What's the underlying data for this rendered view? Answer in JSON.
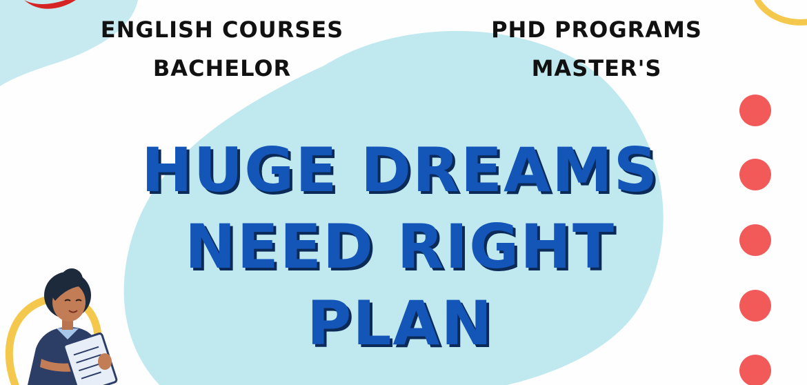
{
  "tags": {
    "left_top": "ENGLISH COURSES",
    "left_bottom": "BACHELOR",
    "right_top": "PHD PROGRAMS",
    "right_bottom": "MASTER'S"
  },
  "headline": {
    "line1": "HUGE DREAMS",
    "line2": "NEED RIGHT",
    "line3": "PLAN"
  },
  "colors": {
    "headline": "#1455b8",
    "headline_shadow": "#0b2a57",
    "blob": "#bfe8ef",
    "dots": "#f25a5a",
    "ring": "#f4c84c",
    "swoosh": "#d62424"
  },
  "decorations": {
    "dot_count": 5,
    "illustration": "woman-holding-clipboard"
  }
}
